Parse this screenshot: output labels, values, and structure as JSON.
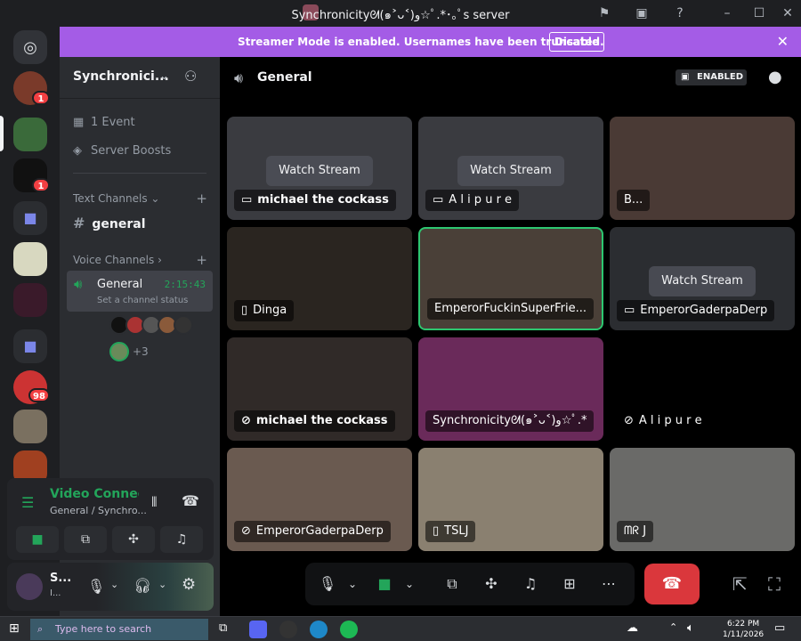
{
  "window": {
    "title": "Synchronicityᘛ(๑˃ᴗ˂)ﻭ☆ﾟ.*･｡ﾟs server"
  },
  "banner": {
    "text": "Streamer Mode is enabled. Usernames have been truncated.",
    "button": "Disable"
  },
  "server_rail": {
    "badges": [
      "1",
      "1",
      "98"
    ]
  },
  "sidebar": {
    "server_name": "Synchronici...",
    "events": "1 Event",
    "boosts": "Server Boosts",
    "text_category": "Text Channels",
    "text_channel": "general",
    "voice_category": "Voice Channels",
    "voice_channel": {
      "name": "General",
      "timer": "2:15:43",
      "status": "Set a channel status"
    },
    "more_users": "+3"
  },
  "voice_panel": {
    "title": "Video Connecte",
    "subtitle": "General / Synchro..."
  },
  "user_panel": {
    "name": "S...",
    "status": "I..."
  },
  "header": {
    "channel": "General",
    "streamer_badge": "ENABLED"
  },
  "tiles": [
    {
      "label": "michael the cockass",
      "watch": "Watch Stream",
      "icon": "monitor-icon"
    },
    {
      "label": "A l i p u r e",
      "watch": "Watch Stream",
      "icon": "monitor-icon"
    },
    {
      "label": "B...",
      "watch": "",
      "icon": ""
    },
    {
      "label": "Dinga",
      "watch": "",
      "icon": "phone-icon"
    },
    {
      "label": "EmperorFuckinSuperFrie...",
      "watch": "",
      "icon": ""
    },
    {
      "label": "EmperorGaderpaDerp",
      "watch": "Watch Stream",
      "icon": "monitor-icon"
    },
    {
      "label": "michael the cockass",
      "watch": "",
      "icon": "mic-off-icon"
    },
    {
      "label": "Synchronicityᘛ(๑˃ᴗ˂)ﻭ☆ﾟ.*",
      "watch": "",
      "icon": ""
    },
    {
      "label": "A l i p u r e",
      "watch": "",
      "icon": "mic-off-icon"
    },
    {
      "label": "EmperorGaderpaDerp",
      "watch": "",
      "icon": "mic-off-icon"
    },
    {
      "label": "TSLJ",
      "watch": "",
      "icon": "phone-icon"
    },
    {
      "label": "ᗰᖇ J",
      "watch": "",
      "icon": ""
    }
  ],
  "taskbar": {
    "search_placeholder": "Type here to search",
    "time": "6:22 PM",
    "date": "1/11/2026"
  }
}
